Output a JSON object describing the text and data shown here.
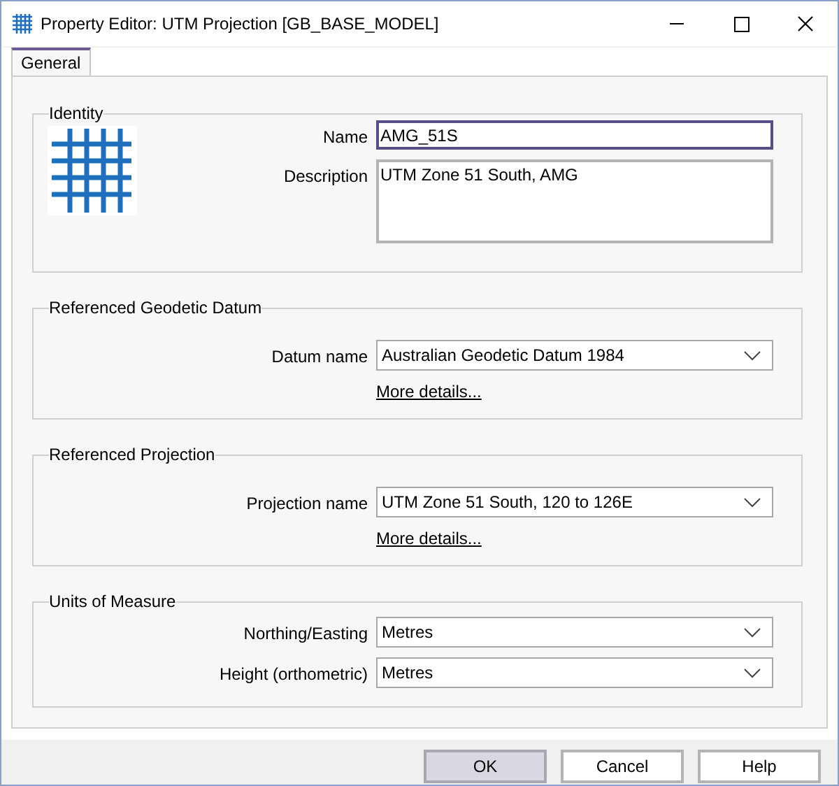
{
  "window": {
    "title": "Property Editor: UTM Projection [GB_BASE_MODEL]"
  },
  "tabs": [
    {
      "label": "General",
      "selected": true
    }
  ],
  "groups": [
    {
      "kind": "identity",
      "title": "Identity",
      "fields": [
        {
          "kind": "text",
          "label": "Name",
          "value": "AMG_51S",
          "focused": true
        },
        {
          "kind": "textarea",
          "label": "Description",
          "value": "UTM Zone 51 South, AMG",
          "focused": false
        }
      ]
    },
    {
      "kind": "reference",
      "title": "Referenced Geodetic Datum",
      "fields": [
        {
          "kind": "dropdown",
          "label": "Datum name",
          "value": "Australian Geodetic Datum 1984",
          "focused": false
        }
      ],
      "link": "More details..."
    },
    {
      "kind": "reference",
      "title": "Referenced Projection",
      "fields": [
        {
          "kind": "dropdown",
          "label": "Projection name",
          "value": "UTM Zone 51 South, 120 to 126E",
          "focused": false
        }
      ],
      "link": "More details..."
    },
    {
      "kind": "units",
      "title": "Units of Measure",
      "fields": [
        {
          "kind": "dropdown",
          "label": "Northing/Easting",
          "value": "Metres",
          "focused": false
        },
        {
          "kind": "dropdown",
          "label": "Height (orthometric)",
          "value": "Metres",
          "focused": false
        }
      ]
    }
  ],
  "buttons": [
    {
      "label": "OK",
      "default": true
    },
    {
      "label": "Cancel",
      "default": false
    },
    {
      "label": "Help",
      "default": false
    }
  ]
}
